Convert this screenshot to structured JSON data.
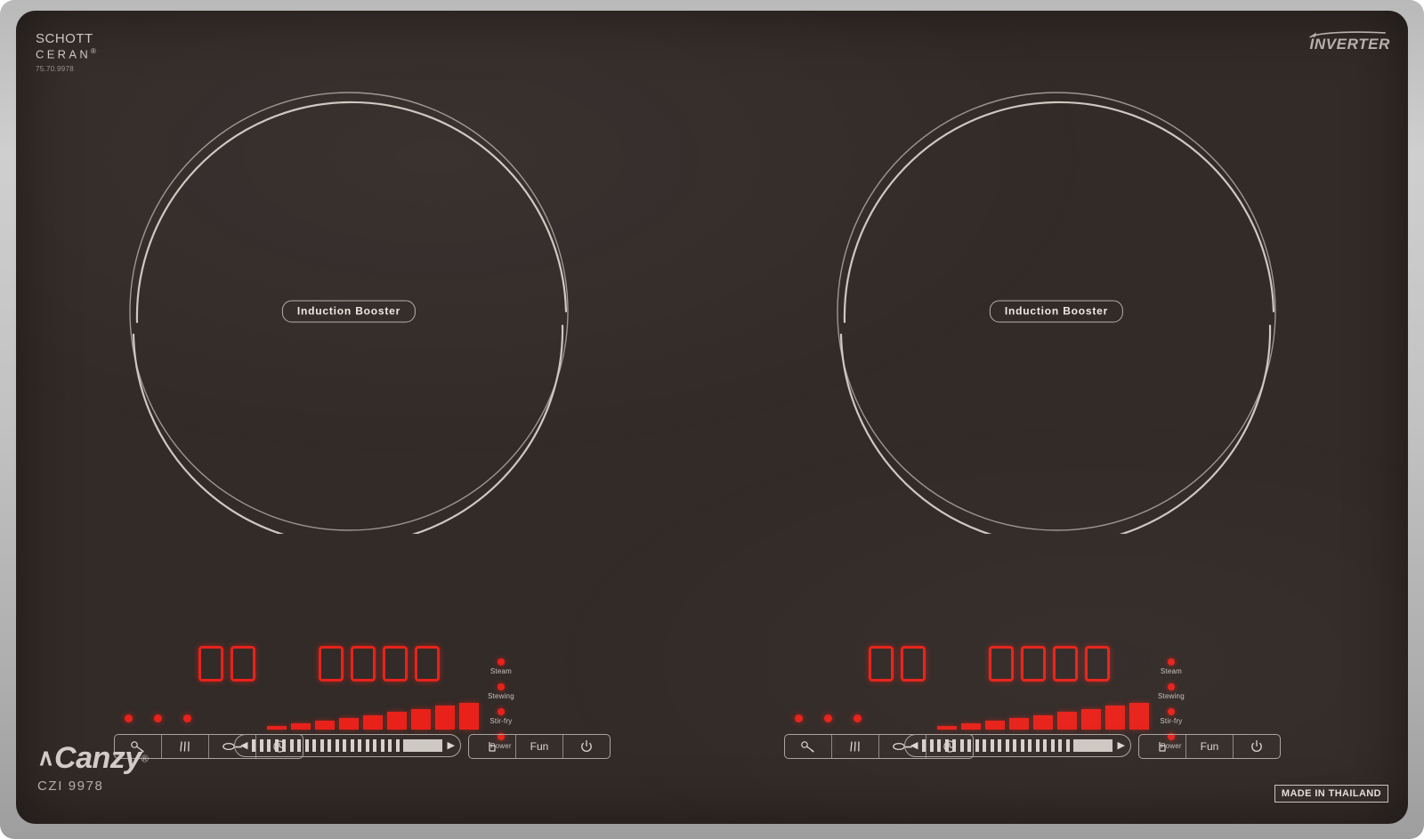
{
  "product": {
    "brand": "Canzy",
    "brand_caret": "∧",
    "brand_reg": "®",
    "model": "CZI 9978",
    "made_in": "MADE IN THAILAND",
    "inverter_label": "INVERTER"
  },
  "glass_brand": {
    "line1": "SCHOTT",
    "line2": "CERAN",
    "reg": "®",
    "code": "75.70.9978"
  },
  "colors": {
    "glass": "#332b28",
    "frame": "#c2c2c2",
    "led_red": "#e8221a",
    "silkscreen": "#ddd7d1"
  },
  "zones": [
    {
      "id": "left-zone",
      "label": "Induction Booster"
    },
    {
      "id": "right-zone",
      "label": "Induction Booster"
    }
  ],
  "panels": [
    {
      "id": "left-panel",
      "timer_display": "00",
      "power_display": "0000",
      "indicator_dots": 3,
      "level_bars": 9,
      "level_active": 9,
      "modes": [
        {
          "label": "Steam",
          "on": true
        },
        {
          "label": "Stewing",
          "on": true
        },
        {
          "label": "Stir-fry",
          "on": true
        },
        {
          "label": "Power",
          "on": true
        }
      ],
      "left_buttons": [
        {
          "name": "child-lock-button",
          "icon": "key-icon",
          "label": ""
        },
        {
          "name": "grill-button",
          "icon": "bars-icon",
          "label": ""
        },
        {
          "name": "pan-button",
          "icon": "frying-pan-icon",
          "label": ""
        },
        {
          "name": "timer-button",
          "icon": "clock-icon",
          "label": ""
        }
      ],
      "slider": {
        "left_arrow": "◀",
        "right_arrow": "▶",
        "ticks": 26
      },
      "right_buttons": [
        {
          "name": "pot-button",
          "icon": "pot-icon",
          "label": ""
        },
        {
          "name": "fun-button",
          "icon": "",
          "label": "Fun"
        },
        {
          "name": "power-button",
          "icon": "power-icon",
          "label": ""
        }
      ]
    },
    {
      "id": "right-panel",
      "timer_display": "00",
      "power_display": "0000",
      "indicator_dots": 3,
      "level_bars": 9,
      "level_active": 9,
      "modes": [
        {
          "label": "Steam",
          "on": true
        },
        {
          "label": "Stewing",
          "on": true
        },
        {
          "label": "Stir-fry",
          "on": true
        },
        {
          "label": "Power",
          "on": true
        }
      ],
      "left_buttons": [
        {
          "name": "child-lock-button",
          "icon": "key-icon",
          "label": ""
        },
        {
          "name": "grill-button",
          "icon": "bars-icon",
          "label": ""
        },
        {
          "name": "pan-button",
          "icon": "frying-pan-icon",
          "label": ""
        },
        {
          "name": "timer-button",
          "icon": "clock-icon",
          "label": ""
        }
      ],
      "slider": {
        "left_arrow": "◀",
        "right_arrow": "▶",
        "ticks": 26
      },
      "right_buttons": [
        {
          "name": "pot-button",
          "icon": "pot-icon",
          "label": ""
        },
        {
          "name": "fun-button",
          "icon": "",
          "label": "Fun"
        },
        {
          "name": "power-button",
          "icon": "power-icon",
          "label": ""
        }
      ]
    }
  ]
}
